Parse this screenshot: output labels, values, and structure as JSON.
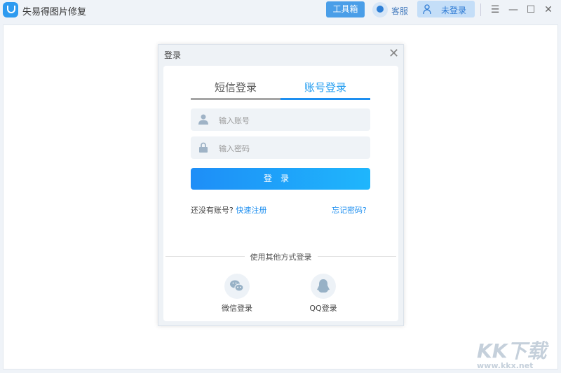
{
  "app": {
    "title": "失易得图片修复",
    "toolbox": "工具箱",
    "service": "客服",
    "login_status": "未登录"
  },
  "dialog": {
    "title": "登录",
    "tabs": [
      {
        "label": "短信登录",
        "active": false
      },
      {
        "label": "账号登录",
        "active": true
      }
    ],
    "account_placeholder": "输入账号",
    "password_placeholder": "输入密码",
    "submit": "登录",
    "no_account": "还没有账号?",
    "register": "快速注册",
    "forgot": "忘记密码?",
    "other": "使用其他方式登录",
    "wechat": "微信登录",
    "qq": "QQ登录"
  },
  "watermark": {
    "brand": "KK下载",
    "url": "www.kkx.net"
  },
  "colors": {
    "accent": "#1e9bf0"
  }
}
